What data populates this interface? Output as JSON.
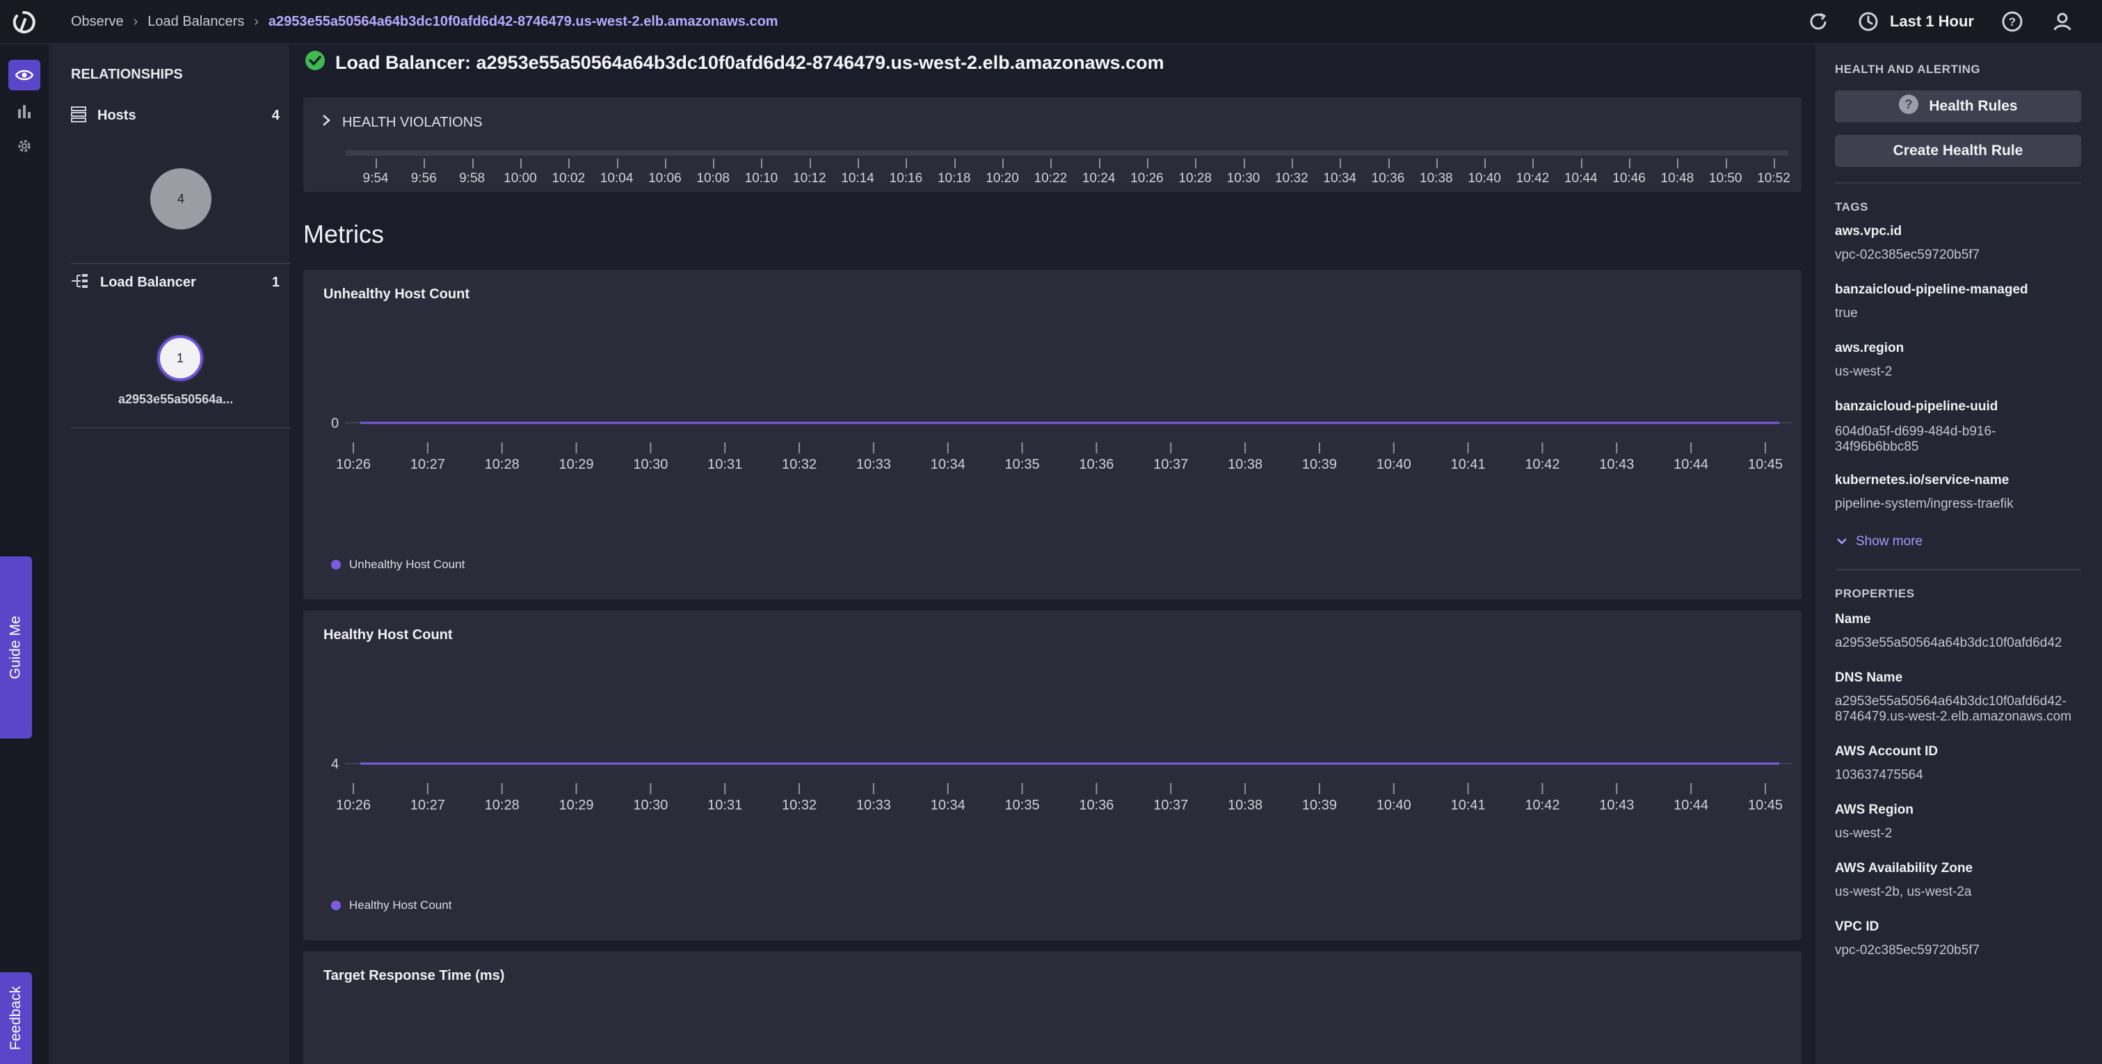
{
  "breadcrumb": {
    "items": [
      "Observe",
      "Load Balancers"
    ],
    "current": "a2953e55a50564a64b3dc10f0afd6d42-8746479.us-west-2.elb.amazonaws.com"
  },
  "topbar": {
    "time_range": "Last 1 Hour",
    "icons": [
      "refresh-icon",
      "clock-icon",
      "help-icon",
      "user-icon"
    ]
  },
  "rail": {
    "icons": [
      "eye-icon",
      "bar-chart-icon",
      "gear-icon"
    ],
    "guide_label": "Guide Me",
    "feedback_label": "Feedback"
  },
  "relationships": {
    "title": "RELATIONSHIPS",
    "hosts": {
      "label": "Hosts",
      "count": "4",
      "node": "4"
    },
    "load_balancer": {
      "label": "Load Balancer",
      "count": "1",
      "node": "1",
      "node_label": "a2953e55a50564a..."
    }
  },
  "main": {
    "title": "Load Balancer: a2953e55a50564a64b3dc10f0afd6d42-8746479.us-west-2.elb.amazonaws.com",
    "status_color": "#3fb950",
    "health_violations": {
      "label": "HEALTH VIOLATIONS",
      "ticks": [
        "9:54",
        "9:56",
        "9:58",
        "10:00",
        "10:02",
        "10:04",
        "10:06",
        "10:08",
        "10:10",
        "10:12",
        "10:14",
        "10:16",
        "10:18",
        "10:20",
        "10:22",
        "10:24",
        "10:26",
        "10:28",
        "10:30",
        "10:32",
        "10:34",
        "10:36",
        "10:38",
        "10:40",
        "10:42",
        "10:44",
        "10:46",
        "10:48",
        "10:50",
        "10:52"
      ]
    },
    "metrics_heading": "Metrics",
    "accent": "#7c5ce0"
  },
  "chart_data": [
    {
      "type": "line",
      "title": "Unhealthy Host Count",
      "x": [
        "10:26",
        "10:27",
        "10:28",
        "10:29",
        "10:30",
        "10:31",
        "10:32",
        "10:33",
        "10:34",
        "10:35",
        "10:36",
        "10:37",
        "10:38",
        "10:39",
        "10:40",
        "10:41",
        "10:42",
        "10:43",
        "10:44",
        "10:45"
      ],
      "series": [
        {
          "name": "Unhealthy Host Count",
          "values": [
            0,
            0,
            0,
            0,
            0,
            0,
            0,
            0,
            0,
            0,
            0,
            0,
            0,
            0,
            0,
            0,
            0,
            0,
            0,
            0
          ]
        }
      ],
      "y_ticks": [
        "0"
      ]
    },
    {
      "type": "line",
      "title": "Healthy Host Count",
      "x": [
        "10:26",
        "10:27",
        "10:28",
        "10:29",
        "10:30",
        "10:31",
        "10:32",
        "10:33",
        "10:34",
        "10:35",
        "10:36",
        "10:37",
        "10:38",
        "10:39",
        "10:40",
        "10:41",
        "10:42",
        "10:43",
        "10:44",
        "10:45"
      ],
      "series": [
        {
          "name": "Healthy Host Count",
          "values": [
            4,
            4,
            4,
            4,
            4,
            4,
            4,
            4,
            4,
            4,
            4,
            4,
            4,
            4,
            4,
            4,
            4,
            4,
            4,
            4
          ]
        }
      ],
      "y_ticks": [
        "4"
      ]
    },
    {
      "type": "line",
      "title": "Target Response Time (ms)",
      "series": []
    }
  ],
  "sidebar": {
    "health_title": "HEALTH AND ALERTING",
    "health_rules_label": "Health Rules",
    "create_rule_label": "Create Health Rule",
    "tags_title": "TAGS",
    "tags": [
      {
        "key": "aws.vpc.id",
        "value": "vpc-02c385ec59720b5f7"
      },
      {
        "key": "banzaicloud-pipeline-managed",
        "value": "true"
      },
      {
        "key": "aws.region",
        "value": "us-west-2"
      },
      {
        "key": "banzaicloud-pipeline-uuid",
        "value": "604d0a5f-d699-484d-b916-34f96b6bbc85"
      },
      {
        "key": "kubernetes.io/service-name",
        "value": "pipeline-system/ingress-traefik"
      }
    ],
    "show_more_label": "Show more",
    "properties_title": "PROPERTIES",
    "properties": [
      {
        "key": "Name",
        "value": "a2953e55a50564a64b3dc10f0afd6d42"
      },
      {
        "key": "DNS Name",
        "value": "a2953e55a50564a64b3dc10f0afd6d42-8746479.us-west-2.elb.amazonaws.com"
      },
      {
        "key": "AWS Account ID",
        "value": "103637475564"
      },
      {
        "key": "AWS Region",
        "value": "us-west-2"
      },
      {
        "key": "AWS Availability Zone",
        "value": "us-west-2b, us-west-2a"
      },
      {
        "key": "VPC ID",
        "value": "vpc-02c385ec59720b5f7"
      }
    ]
  }
}
